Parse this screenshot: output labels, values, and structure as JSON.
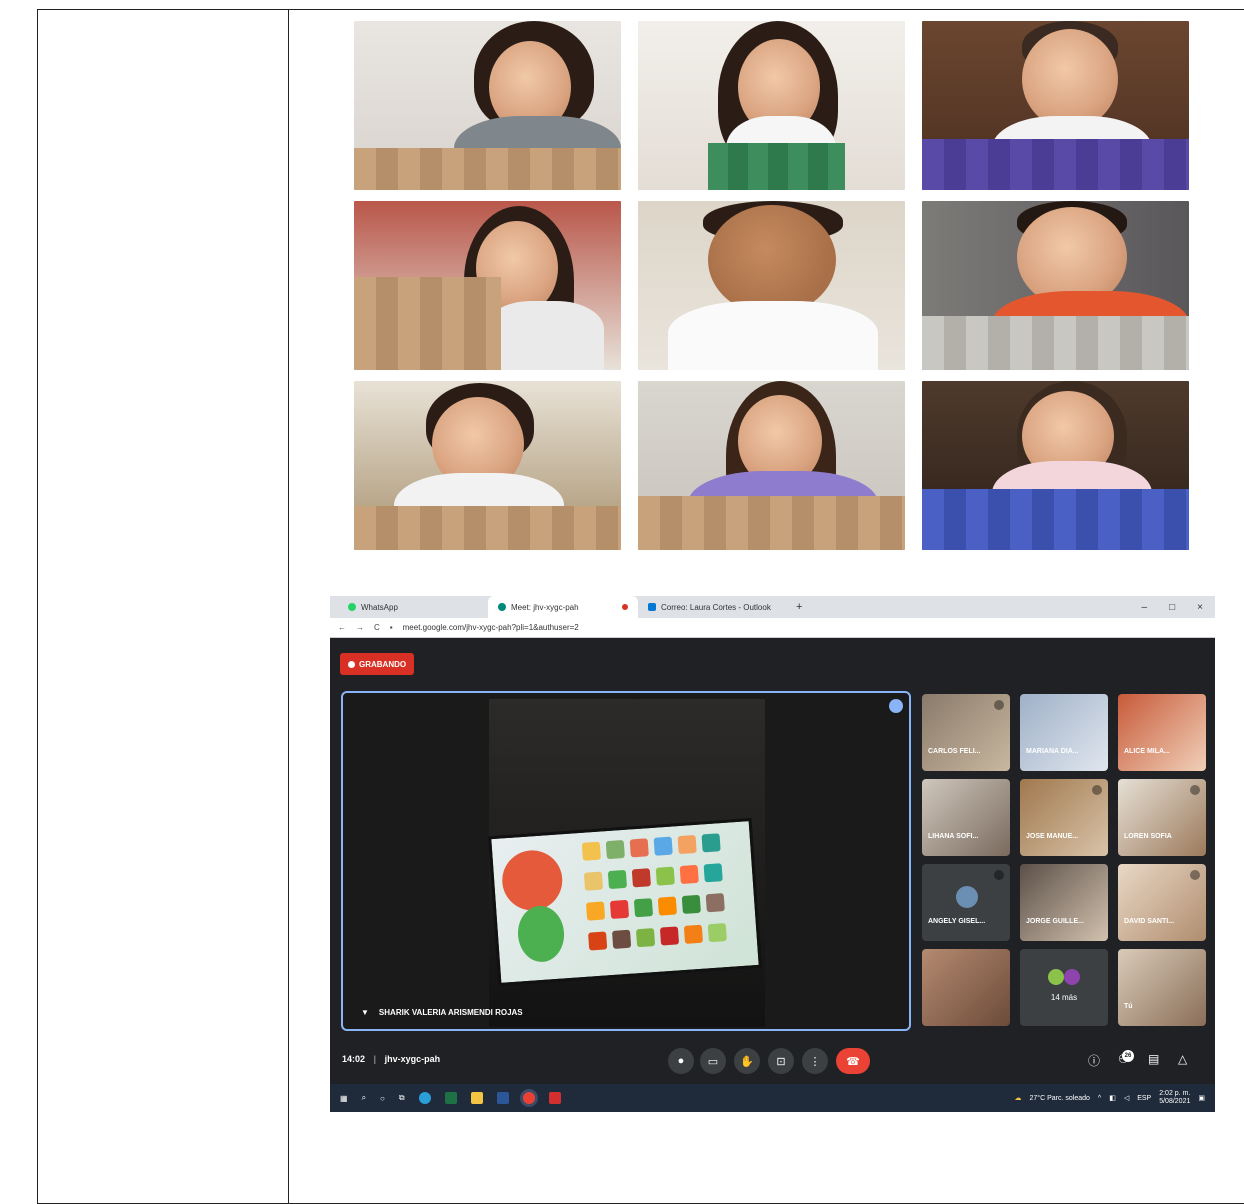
{
  "browser": {
    "tabs": [
      {
        "label": "WhatsApp",
        "color": "#25d366"
      },
      {
        "label": "Meet: jhv-xygc-pah",
        "color": "#00897b"
      },
      {
        "label": "Correo: Laura Cortes - Outlook",
        "color": "#0078d4"
      }
    ],
    "url": "meet.google.com/jhv-xygc-pah?pli=1&authuser=2"
  },
  "meet": {
    "recording_label": "GRABANDO",
    "speaker_name": "SHARIK VALERIA ARISMENDI ROJAS",
    "time": "14:02",
    "meeting_code": "jhv-xygc-pah",
    "participants_count": "26",
    "participants": [
      {
        "name": "CARLOS FELI..."
      },
      {
        "name": "MARIANA DIA..."
      },
      {
        "name": "ALICE MILA..."
      },
      {
        "name": "LIHANA SOFI..."
      },
      {
        "name": "JOSE MANUE..."
      },
      {
        "name": "LOREN SOFIA"
      },
      {
        "name": "ANGELY GISEL..."
      },
      {
        "name": "JORGE GUILLE..."
      },
      {
        "name": "DAVID SANTI..."
      },
      {
        "name": ""
      },
      {
        "name": "14 más"
      },
      {
        "name": "Tú"
      }
    ]
  },
  "taskbar": {
    "weather": "27°C  Parc. soleado",
    "lang": "ESP",
    "clock_time": "2:02 p. m.",
    "clock_date": "5/08/2021"
  },
  "colors": {
    "record_red": "#d93025",
    "hangup_red": "#ea4335",
    "meet_bg": "#202124",
    "accent_blue": "#8ab4f8"
  }
}
